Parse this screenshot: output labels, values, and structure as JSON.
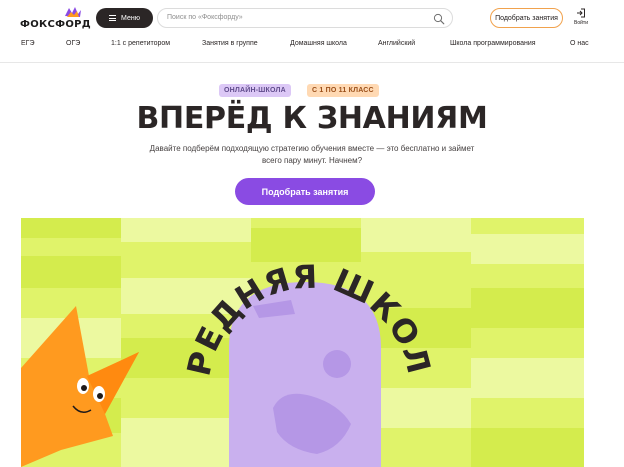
{
  "header": {
    "logo_text": "ФОКСФОРД",
    "menu_label": "Меню",
    "search_placeholder": "Поиск по «Фоксфорду»",
    "pick_button": "Подобрать занятия",
    "login_label": "Войти"
  },
  "nav": {
    "items": [
      {
        "label": "ЕГЭ"
      },
      {
        "label": "ОГЭ"
      },
      {
        "label": "1:1 с репетитором"
      },
      {
        "label": "Занятия в группе"
      },
      {
        "label": "Домашняя школа"
      },
      {
        "label": "Английский"
      },
      {
        "label": "Школа программирования"
      },
      {
        "label": "О нас"
      }
    ]
  },
  "hero": {
    "badge_online": "ОНЛАЙН-ШКОЛА",
    "badge_class": "С 1 ПО 11 КЛАСС",
    "title": "ВПЕРЁД К ЗНАНИЯМ",
    "subtitle": "Давайте подберём подходящую стратегию обучения вместе — это бесплатно и займет всего пару минут. Начнем?",
    "cta": "Подобрать занятия"
  },
  "banner": {
    "arc_text": "СРЕДНЯЯ ШКОЛА"
  },
  "colors": {
    "accent_purple": "#8a4be3",
    "banner_lime": "#e0f36a",
    "banner_lime_light": "#ecf9a0",
    "fox_orange": "#ff9a1f",
    "pill_lavender": "#c9b0ee",
    "text_dark": "#2b2626"
  }
}
